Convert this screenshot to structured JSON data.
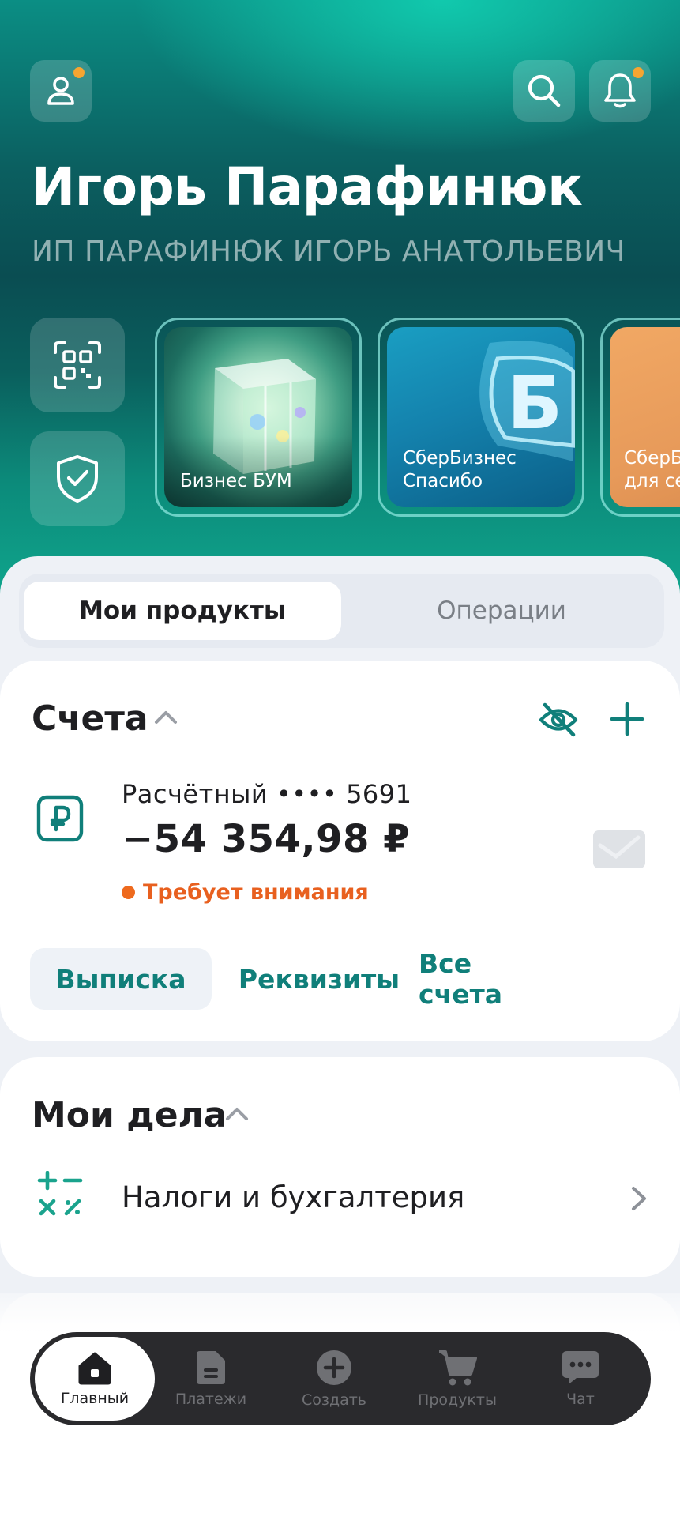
{
  "header": {
    "user_name": "Игорь Парафинюк",
    "org_name": "ИП ПАРАФИНЮК ИГОРЬ АНАТОЛЬЕВИЧ",
    "profile_has_badge": true,
    "notifications_has_badge": true
  },
  "stories": [
    {
      "label": "Бизнес БУМ"
    },
    {
      "label": "СберБизнес\nСпасибо"
    },
    {
      "label": "СберБ\nдля се"
    }
  ],
  "tabs": [
    {
      "label": "Мои продукты",
      "active": true
    },
    {
      "label": "Операции",
      "active": false
    }
  ],
  "accounts": {
    "title": "Счета",
    "account_name": "Расчётный •••• 5691",
    "balance": "−54 354,98 ₽",
    "status": "Требует внимания",
    "actions": [
      "Выписка",
      "Реквизиты",
      "Все счета"
    ]
  },
  "tasks": {
    "title": "Мои дела",
    "items": [
      {
        "label": "Налоги и бухгалтерия"
      }
    ]
  },
  "bottom_nav": [
    {
      "label": "Главный",
      "icon": "home-icon",
      "active": true
    },
    {
      "label": "Платежи",
      "icon": "document-icon",
      "active": false
    },
    {
      "label": "Создать",
      "icon": "plus-circle-icon",
      "active": false
    },
    {
      "label": "Продукты",
      "icon": "cart-icon",
      "active": false
    },
    {
      "label": "Чат",
      "icon": "chat-icon",
      "active": false
    }
  ],
  "colors": {
    "accent_teal": "#107f7a",
    "warning_orange": "#e8601f",
    "badge_orange": "#f7a531",
    "nav_bg": "#2a2a2d"
  }
}
